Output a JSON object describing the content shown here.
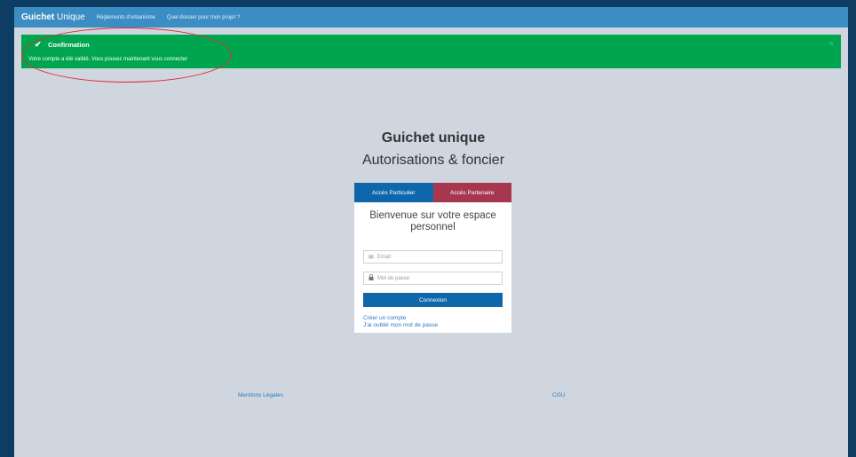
{
  "navbar": {
    "brand_strong": "Guichet",
    "brand_rest": "Unique",
    "links": [
      "Règlements d'urbanisme",
      "Quel dossier pour mon projet ?"
    ]
  },
  "alert": {
    "title": "Confirmation",
    "message": "Votre compte a été validé. Vous pouvez maintenant vous connecter",
    "close": "×",
    "check": "✔",
    "color": "#00a64f"
  },
  "main": {
    "title": "Guichet unique",
    "subtitle": "Autorisations & foncier"
  },
  "login": {
    "tabs": [
      {
        "label": "Accès Particulier",
        "color": "#0e67aa"
      },
      {
        "label": "Accès Partenaire",
        "color": "#a7374f"
      }
    ],
    "welcome": "Bienvenue sur votre espace personnel",
    "email_placeholder": "Email",
    "password_placeholder": "Mot de passe",
    "email_icon": "✉",
    "lock_icon": "🔒",
    "submit_label": "Connexion",
    "create_account": "Créer un compte",
    "forgot_password": "J'ai oublié mon mot de passe"
  },
  "footer": {
    "mentions": "Mentions Légales",
    "cgu": "CGU"
  },
  "colors": {
    "navbar": "#3c8dc4",
    "background": "#d0d6df",
    "frame": "#0d3d63",
    "annotation": "#e0282e"
  }
}
